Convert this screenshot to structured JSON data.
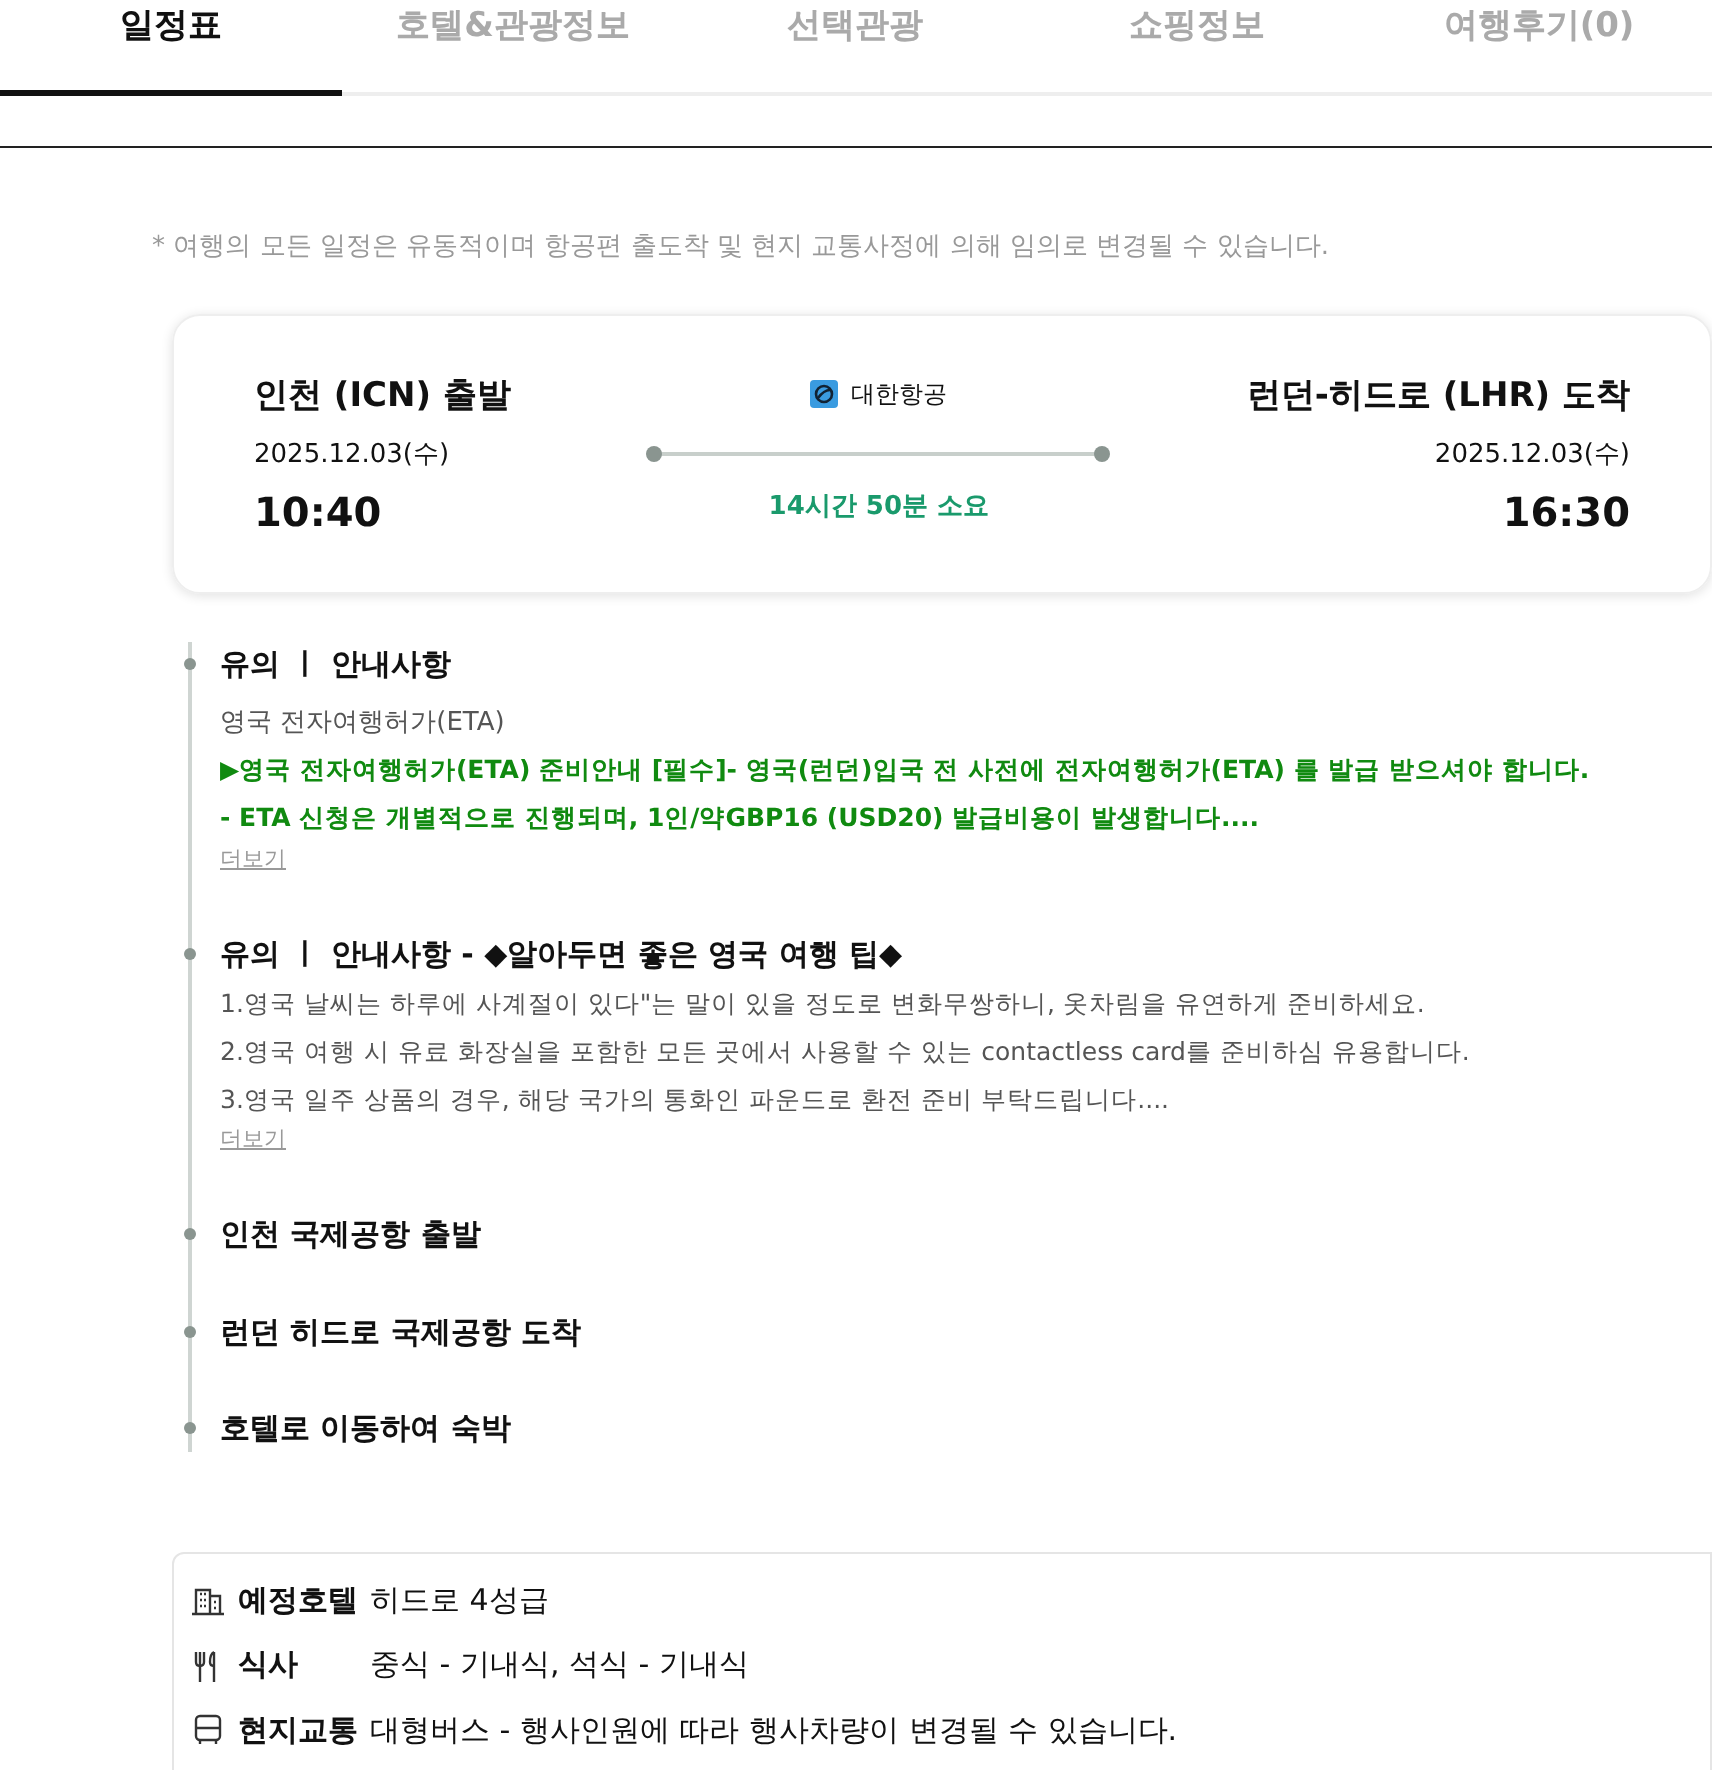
{
  "tabs": [
    {
      "label": "일정표",
      "selected": true
    },
    {
      "label": "호텔&관광정보",
      "selected": false
    },
    {
      "label": "선택관광",
      "selected": false
    },
    {
      "label": "쇼핑정보",
      "selected": false
    },
    {
      "label": "여행후기(0)",
      "selected": false
    }
  ],
  "notice": "* 여행의 모든 일정은 유동적이며 항공편 출도착 및 현지 교통사정에 의해 임의로 변경될 수 있습니다.",
  "flight": {
    "departure": {
      "place": "인천 (ICN) 출발",
      "date": "2025.12.03(수)",
      "time": "10:40"
    },
    "airline": "대한항공",
    "duration": "14시간 50분 소요",
    "arrival": {
      "place": "런던-히드로 (LHR) 도착",
      "date": "2025.12.03(수)",
      "time": "16:30"
    }
  },
  "timeline": [
    {
      "kind": "notice",
      "title": "유의 ㅣ 안내사항",
      "subtitle": "영국 전자여행허가(ETA)",
      "lines": [
        {
          "text": "▶영국 전자여행허가(ETA) 준비안내 [필수]- 영국(런던)입국 전 사전에 전자여행허가(ETA) 를 발급 받으셔야 합니다.",
          "highlight": true
        },
        {
          "text": "- ETA 신청은 개별적으로 진행되며, 1인/약GBP16 (USD20) 발급비용이 발생합니다....",
          "highlight": true
        }
      ],
      "more": "더보기"
    },
    {
      "kind": "notice",
      "title": "유의 ㅣ 안내사항 - ◆알아두면 좋은 영국 여행 팁◆",
      "lines": [
        {
          "text": "1.영국 날씨는 하루에 사계절이 있다\"는 말이 있을 정도로 변화무쌍하니, 옷차림을 유연하게 준비하세요.",
          "highlight": false
        },
        {
          "text": "2.영국 여행 시 유료 화장실을 포함한 모든 곳에서 사용할 수 있는 contactless card를 준비하심 유용합니다.",
          "highlight": false
        },
        {
          "text": "3.영국 일주 상품의 경우, 해당 국가의 통화인 파운드로 환전 준비 부탁드립니다....",
          "highlight": false
        }
      ],
      "more": "더보기"
    },
    {
      "kind": "step",
      "title": "인천 국제공항 출발"
    },
    {
      "kind": "step",
      "title": "런던 히드로 국제공항 도착"
    },
    {
      "kind": "step",
      "title": "호텔로 이동하여 숙박"
    }
  ],
  "day_info": [
    {
      "kind": "hotel",
      "label": "예정호텔",
      "value": "히드로 4성급"
    },
    {
      "kind": "meal",
      "label": "식사",
      "value": "중식 - 기내식, 석식 - 기내식"
    },
    {
      "kind": "transport",
      "label": "현지교통",
      "value": "대형버스 - 행사인원에 따라 행사차량이 변경될 수 있습니다."
    }
  ]
}
